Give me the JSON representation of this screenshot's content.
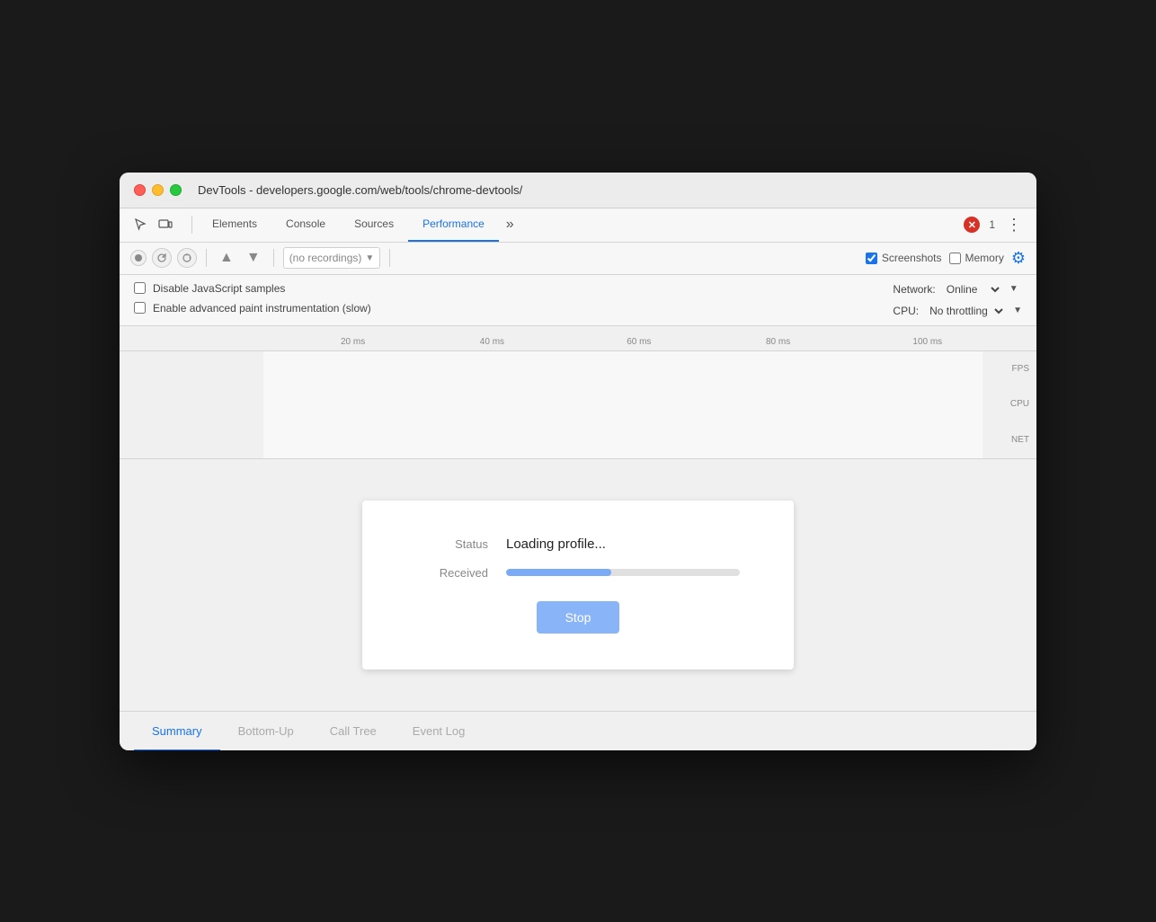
{
  "window": {
    "title": "DevTools - developers.google.com/web/tools/chrome-devtools/"
  },
  "tabs": {
    "items": [
      {
        "id": "elements",
        "label": "Elements",
        "active": false
      },
      {
        "id": "console",
        "label": "Console",
        "active": false
      },
      {
        "id": "sources",
        "label": "Sources",
        "active": false
      },
      {
        "id": "performance",
        "label": "Performance",
        "active": true
      }
    ],
    "more_icon": "»",
    "error_count": "1",
    "menu_icon": "⋮"
  },
  "toolbar": {
    "recording_placeholder": "(no recordings)",
    "screenshots_label": "Screenshots",
    "memory_label": "Memory"
  },
  "settings": {
    "disable_js_label": "Disable JavaScript samples",
    "enable_paint_label": "Enable advanced paint instrumentation (slow)",
    "network_label": "Network:",
    "network_value": "Online",
    "cpu_label": "CPU:",
    "cpu_value": "No throttling"
  },
  "timeline": {
    "ticks": [
      "20 ms",
      "40 ms",
      "60 ms",
      "80 ms",
      "100 ms"
    ],
    "right_labels": [
      "FPS",
      "CPU",
      "NET"
    ]
  },
  "dialog": {
    "status_label": "Status",
    "status_value": "Loading profile...",
    "received_label": "Received",
    "progress_percent": 45,
    "stop_label": "Stop"
  },
  "bottom_tabs": {
    "items": [
      {
        "id": "summary",
        "label": "Summary",
        "active": true
      },
      {
        "id": "bottom-up",
        "label": "Bottom-Up",
        "active": false
      },
      {
        "id": "call-tree",
        "label": "Call Tree",
        "active": false
      },
      {
        "id": "event-log",
        "label": "Event Log",
        "active": false
      }
    ]
  }
}
